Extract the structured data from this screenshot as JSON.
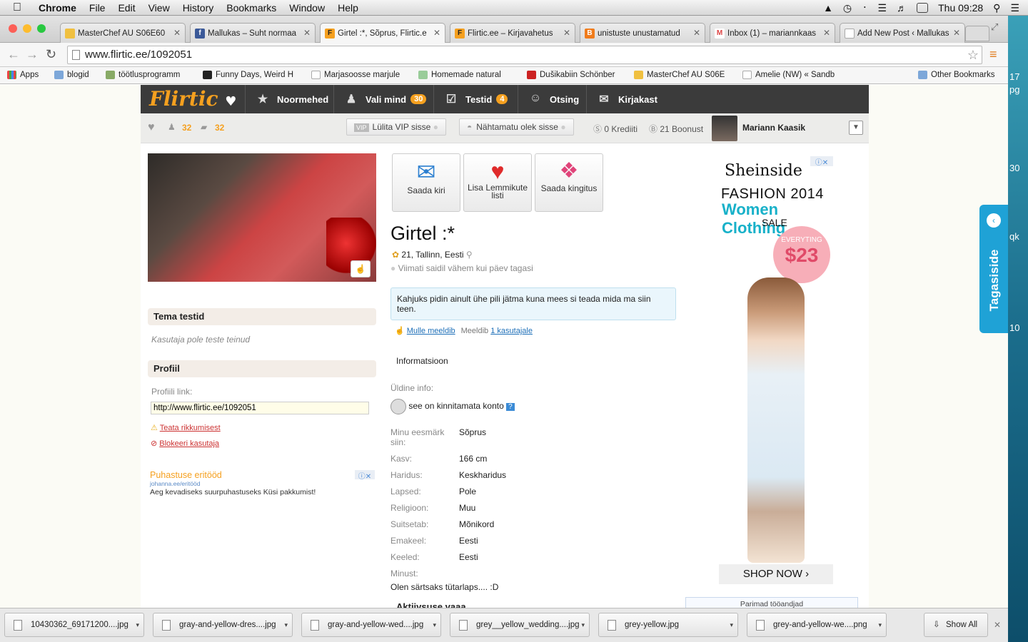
{
  "menubar": {
    "app": "Chrome",
    "items": [
      "File",
      "Edit",
      "View",
      "History",
      "Bookmarks",
      "Window",
      "Help"
    ],
    "clock": "Thu 09:28"
  },
  "desktop": {
    "labels": [
      "17",
      "pg",
      "30",
      "qk",
      "10"
    ]
  },
  "tabs": [
    {
      "title": "MasterChef AU S06E60",
      "fav": "#f0c040"
    },
    {
      "title": "Mallukas – Suht normaa",
      "fav": "#3b5998"
    },
    {
      "title": "Girtel :*, Sõprus, Flirtic.e",
      "fav": "#f5a01f"
    },
    {
      "title": "Flirtic.ee – Kirjavahetus",
      "fav": "#f5a01f"
    },
    {
      "title": "unistuste unustamatud",
      "fav": "#f07c1c"
    },
    {
      "title": "Inbox (1) – mariannkaas",
      "fav": "#d44"
    },
    {
      "title": "Add New Post ‹ Mallukas",
      "fav": "#ccc"
    }
  ],
  "address": {
    "url": "www.flirtic.ee/1092051"
  },
  "bookmarks": [
    "Apps",
    "blogid",
    "töötlusprogramm",
    "Funny Days, Weird H",
    "Marjasoosse marjule",
    "Homemade natural",
    "Dušikabiin Schönber",
    "MasterChef AU S06E",
    "Amelie (NW) « Sandb",
    "Other Bookmarks"
  ],
  "site": {
    "logo": "Flirtic",
    "nav": [
      {
        "label": "Noormehed",
        "badge": ""
      },
      {
        "label": "Vali mind",
        "badge": "30"
      },
      {
        "label": "Testid",
        "badge": "4"
      },
      {
        "label": "Otsing",
        "badge": ""
      },
      {
        "label": "Kirjakast",
        "badge": ""
      }
    ],
    "sub": {
      "count1": "32",
      "count2": "32",
      "vip": "Lülita VIP sisse",
      "vip_tag": "VIP",
      "invisible": "Nähtamatu olek sisse",
      "credits": "0 Krediiti",
      "bonus": "21 Boonust",
      "user": "Mariann Kaasik"
    },
    "actions": [
      "Saada kiri",
      "Lisa Lemmikute listi",
      "Saada kingitus"
    ],
    "profile": {
      "name": "Girtel :*",
      "info": "21, Tallinn, Eesti",
      "last_seen": "Viimati saidil vähem kui päev tagasi",
      "status": "Kahjuks pidin ainult ühe pili jätma kuna mees si teada mida ma siin teen.",
      "like": "Mulle meeldib",
      "liked_by": "Meeldib",
      "liked_count": "1 kasutajale",
      "info_tab": "Informatsioon",
      "general": "Üldine info:",
      "unverified": "see on kinnitamata konto"
    },
    "fields": [
      {
        "k": "Minu eesmärk siin:",
        "v": "Sõprus"
      },
      {
        "k": "Kasv:",
        "v": "166 cm"
      },
      {
        "k": "Haridus:",
        "v": "Keskharidus"
      },
      {
        "k": "Lapsed:",
        "v": "Pole"
      },
      {
        "k": "Religioon:",
        "v": "Muu"
      },
      {
        "k": "Suitsetab:",
        "v": "Mõnikord"
      },
      {
        "k": "Emakeel:",
        "v": "Eesti"
      },
      {
        "k": "Keeled:",
        "v": "Eesti"
      },
      {
        "k": "Minust:",
        "v": ""
      }
    ],
    "about": "Olen särtsaks tütarlaps.... :D",
    "activity": "Aktiivsuse vaaa",
    "left": {
      "tests_title": "Tema testid",
      "tests_empty": "Kasutaja pole teste teinud",
      "profile_title": "Profiil",
      "profile_link_label": "Profiili link:",
      "profile_link": "http://www.flirtic.ee/1092051",
      "report": "Teata rikkumisest",
      "block": "Blokeeri kasutaja",
      "ad_title": "Puhastuse eritööd",
      "ad_url": "johanna.ee/eritööd",
      "ad_text": "Aeg kevadiseks suurpuhastuseks Küsi pakkumist!"
    },
    "ad": {
      "brand": "Sheinside",
      "line1": "FASHION 2014",
      "line2": "Women Clothing",
      "line3": "SALE",
      "price_tag": "EVERYTING",
      "price": "$23",
      "cta": "SHOP NOW ›"
    },
    "small_ad": "Parimad tööandjad",
    "feedback": "Tagasiside"
  },
  "downloads": [
    "10430362_69171200....jpg",
    "gray-and-yellow-dres....jpg",
    "gray-and-yellow-wed....jpg",
    "grey__yellow_wedding....jpg",
    "grey-yellow.jpg",
    "grey-and-yellow-we....png"
  ],
  "show_all": "Show All"
}
